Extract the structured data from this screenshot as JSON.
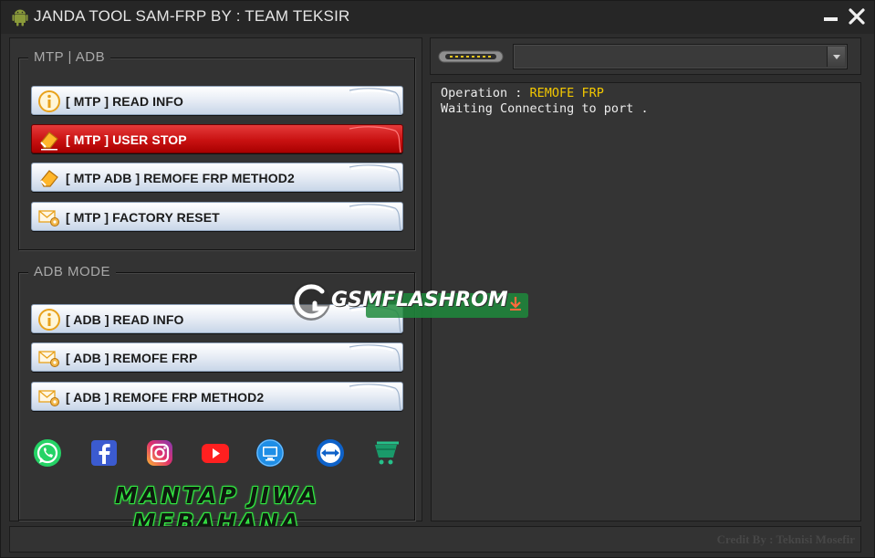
{
  "window": {
    "title": "JANDA TOOL SAM-FRP BY : TEAM TEKSIR"
  },
  "mtp_group": {
    "legend": "MTP | ADB",
    "buttons": [
      {
        "label": "[ MTP ] READ INFO",
        "icon": "info-icon"
      },
      {
        "label": "[ MTP ] USER STOP",
        "icon": "eraser-icon",
        "active": true
      },
      {
        "label": "[ MTP ADB ] REMOFE FRP METHOD2",
        "icon": "eraser-icon"
      },
      {
        "label": "[ MTP ] FACTORY RESET",
        "icon": "mail-gear-icon"
      }
    ]
  },
  "adb_group": {
    "legend": "ADB MODE",
    "buttons": [
      {
        "label": "[ ADB ] READ INFO",
        "icon": "info-icon"
      },
      {
        "label": "[ ADB ] REMOFE FRP",
        "icon": "mail-gear-icon"
      },
      {
        "label": "[ ADB ] REMOFE FRP METHOD2",
        "icon": "mail-gear-icon"
      }
    ]
  },
  "social_links": [
    "whatsapp-icon",
    "facebook-icon",
    "instagram-icon",
    "youtube-icon",
    "remote-desktop-icon",
    "teamviewer-icon",
    "shop-cart-icon"
  ],
  "banner": "MANTAP JIWA MEBAHANA",
  "port": {
    "selected": ""
  },
  "log": {
    "operation_label": "Operation : ",
    "operation_value": "REMOFE FRP",
    "status": "Waiting Connecting to port ."
  },
  "status_bar": {
    "credit": "Credit By : Teknisi Mosefir"
  },
  "watermark": {
    "text": "GSMFLASHROM"
  },
  "colors": {
    "accent_red": "#c91212",
    "log_highlight": "#f2c700",
    "banner_glow": "#39ff4a"
  }
}
